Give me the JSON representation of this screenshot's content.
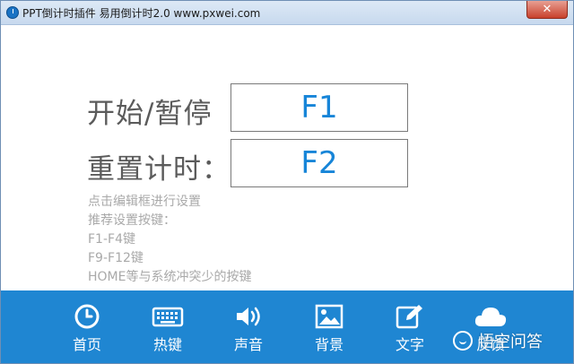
{
  "window": {
    "title": "PPT倒计时插件 易用倒计时2.0 www.pxwei.com",
    "close_label": "✕"
  },
  "shortcuts": [
    {
      "label": "开始/暂停",
      "key": "F1"
    },
    {
      "label": "重置计时：",
      "key": "F2"
    }
  ],
  "hints": [
    "点击编辑框进行设置",
    "推荐设置按键：",
    "F1-F4键",
    "F9-F12键",
    "HOME等与系统冲突少的按键"
  ],
  "toolbar": {
    "items": [
      {
        "label": "首页",
        "icon": "clock-icon"
      },
      {
        "label": "热键",
        "icon": "keyboard-icon"
      },
      {
        "label": "声音",
        "icon": "speaker-icon"
      },
      {
        "label": "背景",
        "icon": "image-icon"
      },
      {
        "label": "文字",
        "icon": "edit-icon"
      },
      {
        "label": "反馈",
        "icon": "cloud-icon"
      }
    ]
  },
  "watermark": {
    "text": "悟空问答"
  },
  "colors": {
    "accent": "#1f86d2",
    "key_text": "#1785d8",
    "label_text": "#5b5b5b",
    "hint_text": "#a9a9a9"
  }
}
